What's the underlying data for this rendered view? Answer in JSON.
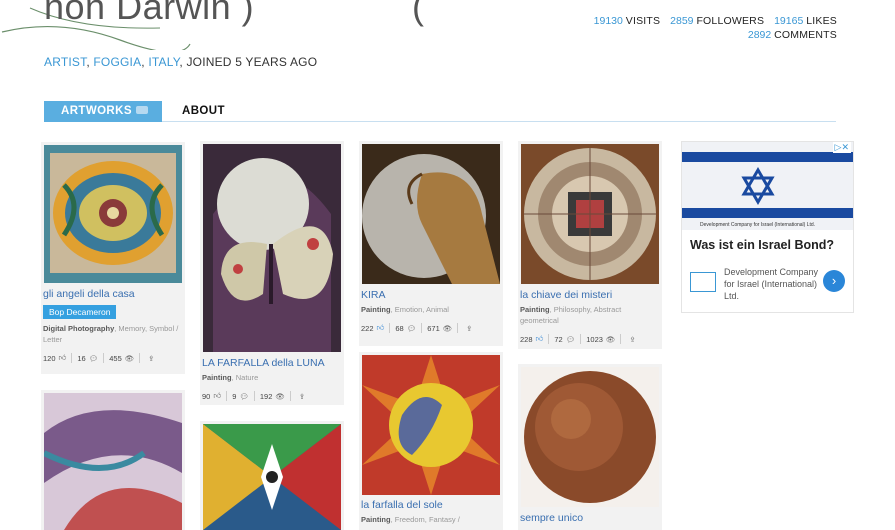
{
  "header": {
    "title": "non Darwin )",
    "title_fragment": "(",
    "role": "ARTIST",
    "city": "FOGGIA",
    "country": "ITALY",
    "joined": "JOINED 5 YEARS AGO"
  },
  "stats": {
    "visits_num": "19130",
    "visits_label": "VISITS",
    "followers_num": "2859",
    "followers_label": "FOLLOWERS",
    "likes_num": "19165",
    "likes_label": "LIKES",
    "comments_num": "2892",
    "comments_label": "COMMENTS"
  },
  "tabs": {
    "artworks": "ARTWORKS",
    "about": "ABOUT"
  },
  "artworks": [
    {
      "title": "gli angeli della casa",
      "badge": "Bop Decameron",
      "category": "Digital Photography",
      "tags": ", Memory, Symbol / Letter",
      "likes": "120",
      "comments": "16",
      "views": "455"
    },
    {
      "title": "LA FARFALLA della LUNA",
      "category": "Painting",
      "tags": ", Nature",
      "likes": "90",
      "comments": "9",
      "views": "192"
    },
    {
      "title": "KIRA",
      "category": "Painting",
      "tags": ", Emotion, Animal",
      "likes": "222",
      "comments": "68",
      "views": "671"
    },
    {
      "title": "la chiave dei misteri",
      "category": "Painting",
      "tags": ", Philosophy, Abstract geometrical",
      "likes": "228",
      "comments": "72",
      "views": "1023"
    },
    {
      "title": "la farfalla del sole",
      "category": "Painting",
      "tags": ", Freedom, Fantasy /"
    },
    {
      "title": "sempre unico"
    }
  ],
  "ad": {
    "adchoices": "▷✕",
    "banner_caption": "Development Company for Israel (International) Ltd.",
    "headline": "Was ist ein Israel Bond?",
    "description": "Development Company for Israel (International) Ltd.",
    "button": "›"
  },
  "colors": {
    "link_blue": "#3a97d4",
    "tab_blue": "#5aaee0",
    "like_blue": "#3a8ad4"
  }
}
